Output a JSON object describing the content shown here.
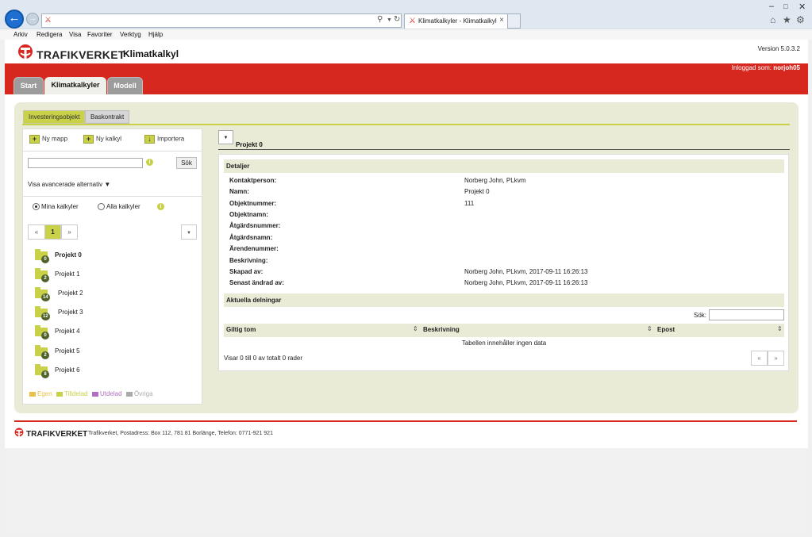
{
  "browser": {
    "tab_title": "Klimatkalkyler - Klimatkalkyl",
    "menu": [
      "Arkiv",
      "Redigera",
      "Visa",
      "Favoriter",
      "Verktyg",
      "Hjälp"
    ]
  },
  "header": {
    "logo_text": "TRAFIKVERKET",
    "app_name": "Klimatkalkyl",
    "version": "Version 5.0.3.2",
    "logged_in_label": "Inloggad som:",
    "logged_in_user": "norjoh05"
  },
  "main_tabs": [
    {
      "label": "Start",
      "active": false
    },
    {
      "label": "Klimatkalkyler",
      "active": true
    },
    {
      "label": "Modell",
      "active": false
    }
  ],
  "sub_tabs": [
    {
      "label": "Investeringsobjekt",
      "active": true
    },
    {
      "label": "Baskontrakt",
      "active": false
    }
  ],
  "left": {
    "tools": [
      {
        "label": "Ny mapp",
        "icon": "plus-icon"
      },
      {
        "label": "Ny kalkyl",
        "icon": "plus-icon"
      },
      {
        "label": "Importera",
        "icon": "import-icon"
      }
    ],
    "search_value": "",
    "search_button": "Sök",
    "advanced_toggle": "Visa avancerade alternativ",
    "radio_mine": "Mina kalkyler",
    "radio_all": "Alla kalkyler",
    "radio_selected": "Mina kalkyler",
    "pager": {
      "prev": "«",
      "current": "1",
      "next": "»"
    },
    "folders": [
      {
        "name": "Projekt 0",
        "count": "0",
        "selected": true
      },
      {
        "name": "Projekt 1",
        "count": "2",
        "selected": false
      },
      {
        "name": "Projekt 2",
        "count": "14",
        "selected": false
      },
      {
        "name": "Projekt 3",
        "count": "12",
        "selected": false
      },
      {
        "name": "Projekt 4",
        "count": "0",
        "selected": false
      },
      {
        "name": "Projekt 5",
        "count": "2",
        "selected": false
      },
      {
        "name": "Projekt 6",
        "count": "8",
        "selected": false
      }
    ],
    "legend": [
      {
        "label": "Egen",
        "color": "#e8c04a"
      },
      {
        "label": "Tilldelad",
        "color": "#c8d148"
      },
      {
        "label": "Utdelad",
        "color": "#b06fc0"
      },
      {
        "label": "Övriga",
        "color": "#aaaaaa"
      }
    ]
  },
  "right": {
    "project_title": "Projekt 0",
    "details_heading": "Detaljer",
    "details": [
      {
        "label": "Kontaktperson:",
        "value": "Norberg John, PLkvm"
      },
      {
        "label": "Namn:",
        "value": "Projekt 0"
      },
      {
        "label": "Objektnummer:",
        "value": "111"
      },
      {
        "label": "Objektnamn:",
        "value": ""
      },
      {
        "label": "Åtgärdsnummer:",
        "value": ""
      },
      {
        "label": "Åtgärdsnamn:",
        "value": ""
      },
      {
        "label": "Ärendenummer:",
        "value": ""
      },
      {
        "label": "Beskrivning:",
        "value": ""
      },
      {
        "label": "Skapad av:",
        "value": "Norberg John, PLkvm, 2017-09-11 16:26:13"
      },
      {
        "label": "Senast ändrad av:",
        "value": "Norberg John, PLkvm, 2017-09-11 16:26:13"
      }
    ],
    "shares_heading": "Aktuella delningar",
    "search_label": "Sök:",
    "search_value": "",
    "columns": [
      "Giltig tom",
      "Beskrivning",
      "Epost"
    ],
    "empty_text": "Tabellen innehåller ingen data",
    "info_text": "Visar 0 till 0 av totalt 0 rader",
    "pager_prev": "«",
    "pager_next": "»"
  },
  "footer": {
    "logo_text": "TRAFIKVERKET",
    "address": "Trafikverket, Postadress: Box 112, 781 81 Borlänge, Telefon: 0771-921 921"
  },
  "colors": {
    "brand_red": "#d6281f",
    "accent_green": "#c8d148",
    "panel_bg": "#e9ebd6"
  }
}
